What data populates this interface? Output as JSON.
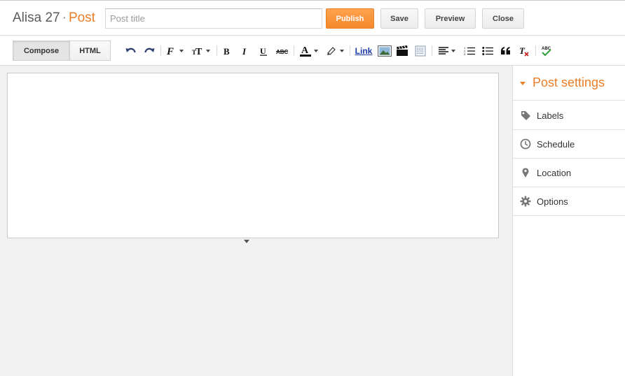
{
  "header": {
    "blog_name": "Alisa 27",
    "separator": "·",
    "post_word": "Post",
    "title_placeholder": "Post title",
    "publish_label": "Publish",
    "save_label": "Save",
    "preview_label": "Preview",
    "close_label": "Close"
  },
  "toolbar": {
    "compose_label": "Compose",
    "html_label": "HTML",
    "link_label": "Link",
    "icons": [
      "undo-icon",
      "redo-icon",
      "font-family-icon",
      "font-size-icon",
      "bold-icon",
      "italic-icon",
      "underline-icon",
      "strikethrough-icon",
      "text-color-icon",
      "highlight-color-icon",
      "link",
      "insert-image-icon",
      "insert-video-icon",
      "insert-jump-break-icon",
      "align-icon",
      "numbered-list-icon",
      "bulleted-list-icon",
      "quote-icon",
      "remove-formatting-icon",
      "spell-check-icon"
    ]
  },
  "sidebar": {
    "title": "Post settings",
    "items": [
      {
        "label": "Labels",
        "icon": "tag-icon"
      },
      {
        "label": "Schedule",
        "icon": "clock-icon"
      },
      {
        "label": "Location",
        "icon": "location-pin-icon"
      },
      {
        "label": "Options",
        "icon": "gear-icon"
      }
    ]
  },
  "colors": {
    "accent": "#ea7d26",
    "publish": "#f4892b",
    "link": "#1a3aa8"
  }
}
